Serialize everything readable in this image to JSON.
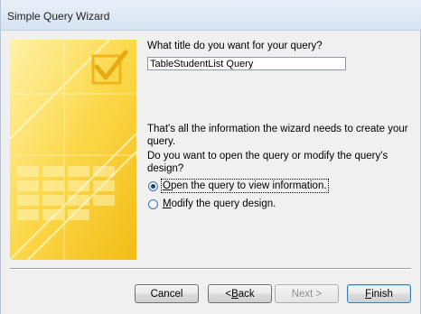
{
  "window": {
    "title": "Simple Query Wizard"
  },
  "question_title": "What title do you want for your query?",
  "title_input": {
    "value": "TableStudentList Query"
  },
  "info_text": "That's all the information the wizard needs to create your query.",
  "question_open": "Do you want to open the query or modify the query's design?",
  "options": [
    {
      "prefix": "",
      "accel": "O",
      "rest": "pen the query to view information.",
      "checked": true
    },
    {
      "prefix": "",
      "accel": "M",
      "rest": "odify the query design.",
      "checked": false
    }
  ],
  "buttons": {
    "cancel": {
      "label": "Cancel"
    },
    "back": {
      "prefix": "< ",
      "accel": "B",
      "rest": "ack"
    },
    "next": {
      "label": "Next >"
    },
    "finish": {
      "prefix": "",
      "accel": "F",
      "rest": "inish"
    }
  },
  "colors": {
    "art_light": "#fbe58a",
    "art_dark": "#f2c21a",
    "accent": "#3c7fb1"
  },
  "icons": {
    "art": "wizard-checkmark-art"
  }
}
